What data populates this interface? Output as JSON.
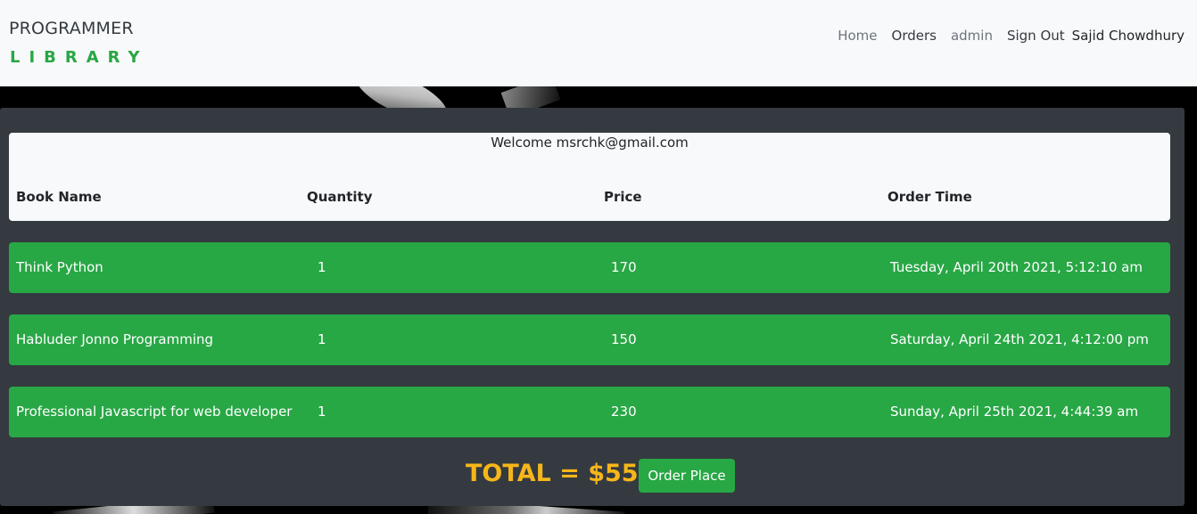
{
  "navbar": {
    "brand_top": "PROGRAMMER",
    "brand_bottom": "LIBRARY",
    "links": {
      "home": "Home",
      "orders": "Orders",
      "admin": "admin",
      "sign_out": "Sign Out",
      "user": "Sajid Chowdhury"
    }
  },
  "orders": {
    "welcome": "Welcome msrchk@gmail.com",
    "columns": {
      "book_name": "Book Name",
      "quantity": "Quantity",
      "price": "Price",
      "order_time": "Order Time"
    },
    "rows": [
      {
        "book": "Think Python",
        "quantity": "1",
        "price": "170",
        "time": "Tuesday, April 20th 2021, 5:12:10 am"
      },
      {
        "book": "Habluder Jonno Programming",
        "quantity": "1",
        "price": "150",
        "time": "Saturday, April 24th 2021, 4:12:00 pm"
      },
      {
        "book": "Professional Javascript for web developer",
        "quantity": "1",
        "price": "230",
        "time": "Sunday, April 25th 2021, 4:44:39 am"
      }
    ],
    "total": "TOTAL = $550",
    "order_button": "Order Place"
  },
  "colors": {
    "accent_green": "#28a745",
    "panel_dark": "#343a40",
    "total_gold": "#f7b619"
  }
}
